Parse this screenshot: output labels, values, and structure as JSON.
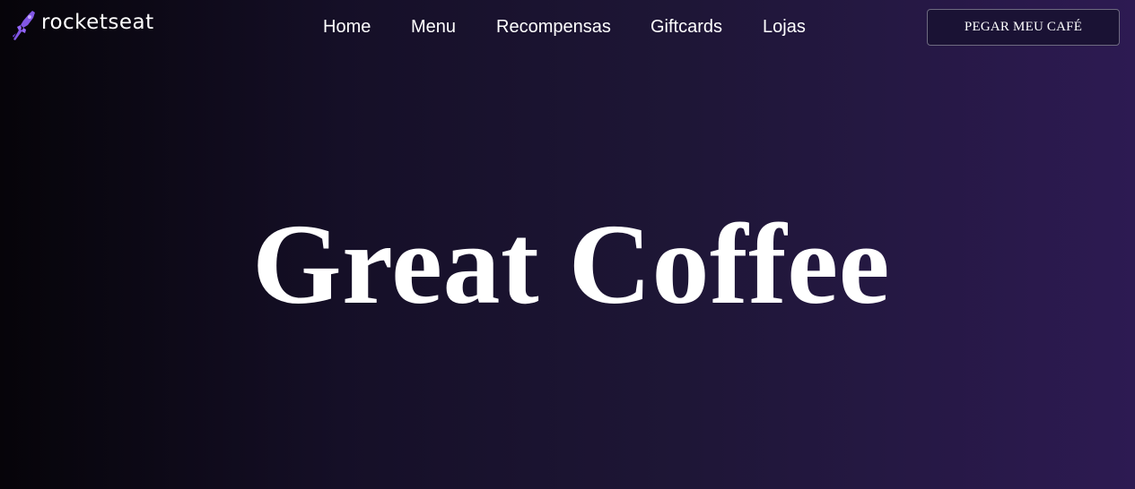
{
  "header": {
    "logo_text": "rocketseat",
    "nav": [
      {
        "label": "Home"
      },
      {
        "label": "Menu"
      },
      {
        "label": "Recompensas"
      },
      {
        "label": "Giftcards"
      },
      {
        "label": "Lojas"
      }
    ],
    "cta_label": "PEGAR MEU CAFÉ"
  },
  "hero": {
    "title": "Great Coffee"
  },
  "colors": {
    "brand_purple": "#8257e5",
    "text": "#ffffff"
  },
  "icons": {
    "logo_icon": "rocket-icon"
  }
}
